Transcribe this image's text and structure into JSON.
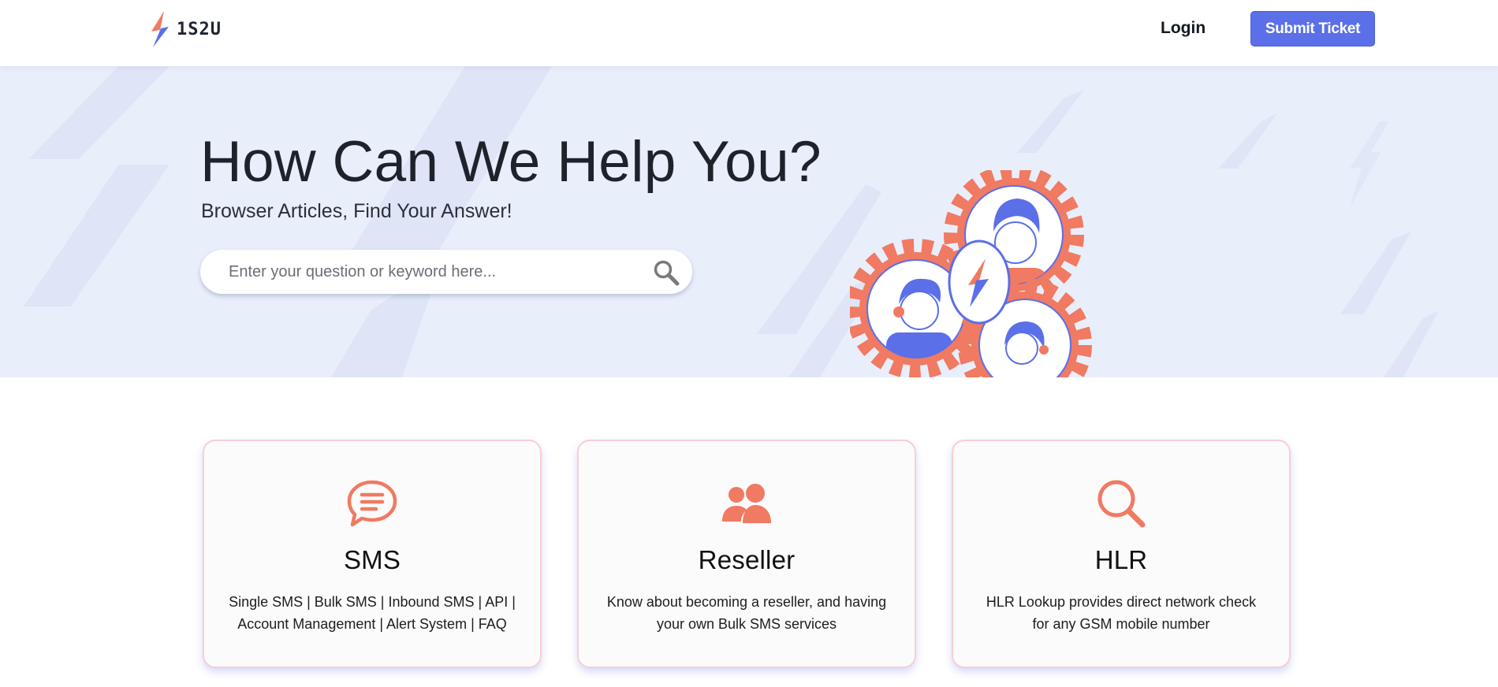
{
  "brand": {
    "name": "1S2U",
    "primary_color": "#5a6fe8",
    "accent_color": "#f07a62"
  },
  "header": {
    "login_label": "Login",
    "submit_label": "Submit Ticket"
  },
  "hero": {
    "title": "How Can We Help You?",
    "subtitle": "Browser Articles, Find Your Answer!",
    "search": {
      "placeholder": "Enter your question or keyword here...",
      "value": "",
      "icon": "search-icon"
    },
    "background_color": "#e9eefb"
  },
  "cards": [
    {
      "icon": "chat-bubble-icon",
      "title": "SMS",
      "description": "Single SMS | Bulk SMS | Inbound SMS | API | Account Management | Alert System | FAQ"
    },
    {
      "icon": "users-icon",
      "title": "Reseller",
      "description": "Know about becoming a reseller, and having your own Bulk SMS services"
    },
    {
      "icon": "magnifier-icon",
      "title": "HLR",
      "description": "HLR Lookup provides direct network check for any GSM mobile number"
    }
  ]
}
